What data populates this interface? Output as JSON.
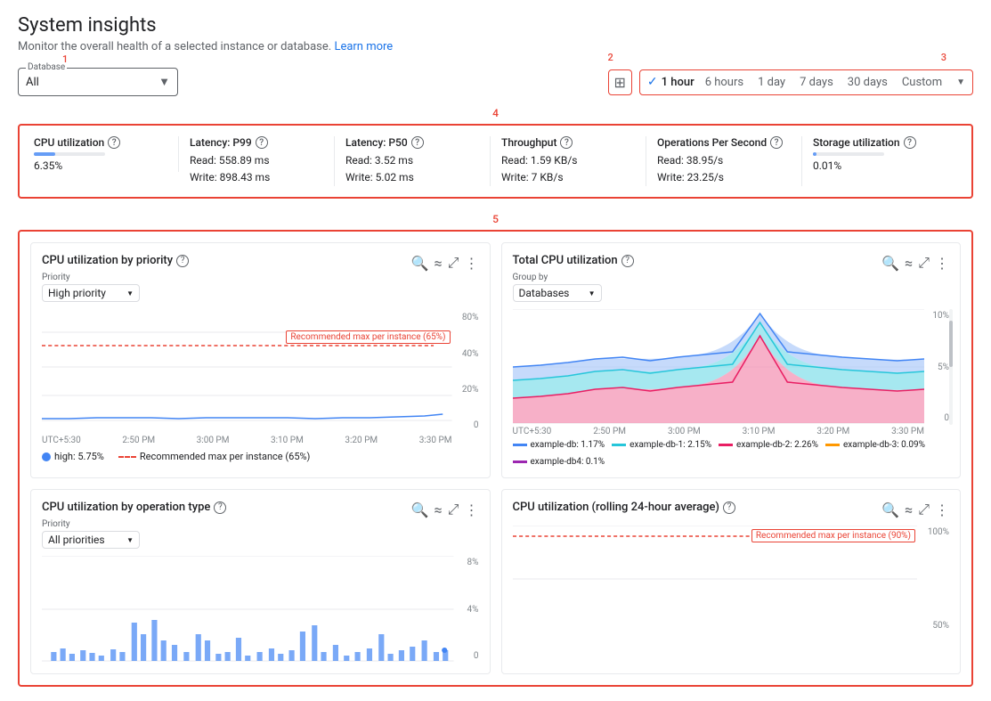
{
  "page": {
    "title": "System insights",
    "description": "Monitor the overall health of a selected instance or database.",
    "learn_more": "Learn more"
  },
  "labels": {
    "num1": "1",
    "num2": "2",
    "num3": "3",
    "num4": "4",
    "num5": "5"
  },
  "database_selector": {
    "label": "Database",
    "value": "All"
  },
  "toolbar": {
    "grid_icon": "⊞",
    "time_options": [
      "1 hour",
      "6 hours",
      "1 day",
      "7 days",
      "30 days",
      "Custom"
    ],
    "active_option": "1 hour",
    "dropdown_arrow": "▼"
  },
  "metrics": [
    {
      "title": "CPU utilization",
      "bar_width": "30",
      "value": "6.35%"
    },
    {
      "title": "Latency: P99",
      "read": "Read: 558.89 ms",
      "write": "Write: 898.43 ms"
    },
    {
      "title": "Latency: P50",
      "read": "Read: 3.52 ms",
      "write": "Write: 5.02 ms"
    },
    {
      "title": "Throughput",
      "read": "Read: 1.59 KB/s",
      "write": "Write: 7 KB/s"
    },
    {
      "title": "Operations Per Second",
      "read": "Read: 38.95/s",
      "write": "Write: 23.25/s"
    },
    {
      "title": "Storage utilization",
      "bar_width": "5",
      "value": "0.01%"
    }
  ],
  "charts": {
    "cpu_priority": {
      "title": "CPU utilization by priority",
      "priority_label": "Priority",
      "priority_value": "High priority",
      "y_labels": [
        "80%",
        "40%",
        "20%",
        "0"
      ],
      "x_labels": [
        "UTC+5:30",
        "2:50 PM",
        "3:00 PM",
        "3:10 PM",
        "3:20 PM",
        "3:30 PM"
      ],
      "recommended_label": "Recommended max per instance (65%)",
      "legend": [
        {
          "type": "dot",
          "color": "#4285f4",
          "label": "high: 5.75%"
        },
        {
          "type": "dashed",
          "color": "#ea4335",
          "label": "Recommended max per instance (65%)"
        }
      ]
    },
    "total_cpu": {
      "title": "Total CPU utilization",
      "group_by_label": "Group by",
      "group_by_value": "Databases",
      "y_labels": [
        "10%",
        "5%",
        "0"
      ],
      "x_labels": [
        "UTC+5:30",
        "2:50 PM",
        "3:00 PM",
        "3:10 PM",
        "3:20 PM",
        "3:30 PM"
      ],
      "legend": [
        {
          "color": "#4285f4",
          "label": "example-db: 1.17%"
        },
        {
          "color": "#00bcd4",
          "label": "example-db-1: 2.15%"
        },
        {
          "color": "#e91e63",
          "label": "example-db-2: 2.26%"
        },
        {
          "color": "#ff9800",
          "label": "example-db-3: 0.09%"
        },
        {
          "color": "#9c27b0",
          "label": "example-db4: 0.1%"
        }
      ]
    },
    "cpu_operation": {
      "title": "CPU utilization by operation type",
      "priority_label": "Priority",
      "priority_value": "All priorities",
      "y_labels": [
        "8%",
        "4%",
        "0"
      ]
    },
    "cpu_rolling": {
      "title": "CPU utilization (rolling 24-hour average)",
      "y_labels": [
        "100%",
        "50%"
      ],
      "recommended_label": "Recommended max per instance (90%)"
    }
  }
}
